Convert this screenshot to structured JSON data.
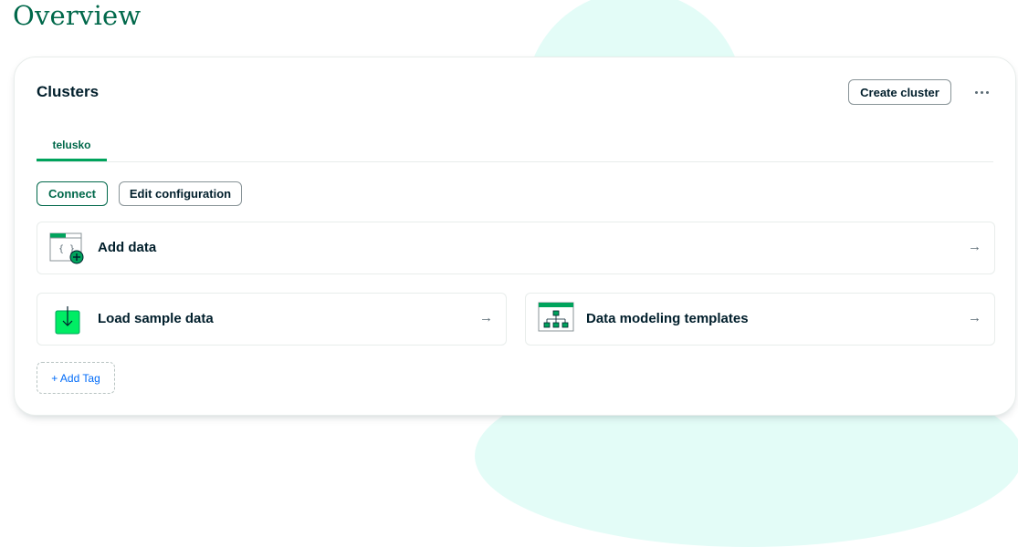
{
  "page": {
    "title": "Overview"
  },
  "clusters": {
    "title": "Clusters",
    "create_label": "Create cluster",
    "more_label": "",
    "tabs": [
      {
        "label": "telusko"
      }
    ],
    "actions": {
      "connect_label": "Connect",
      "edit_label": "Edit configuration"
    },
    "rows": [
      {
        "label": "Add data",
        "icon": "add-data-icon",
        "arrow": "→"
      },
      {
        "label": "Load sample data",
        "icon": "download-icon",
        "arrow": "→"
      },
      {
        "label": "Data modeling templates",
        "icon": "schema-tree-icon",
        "arrow": "→"
      }
    ],
    "add_tag_label": "+ Add Tag"
  },
  "colors": {
    "brand_green": "#00684a",
    "accent_green": "#00a35c",
    "icon_green": "#00ed64",
    "link_blue": "#016bf8",
    "mint_background": "#e3fcf7"
  }
}
